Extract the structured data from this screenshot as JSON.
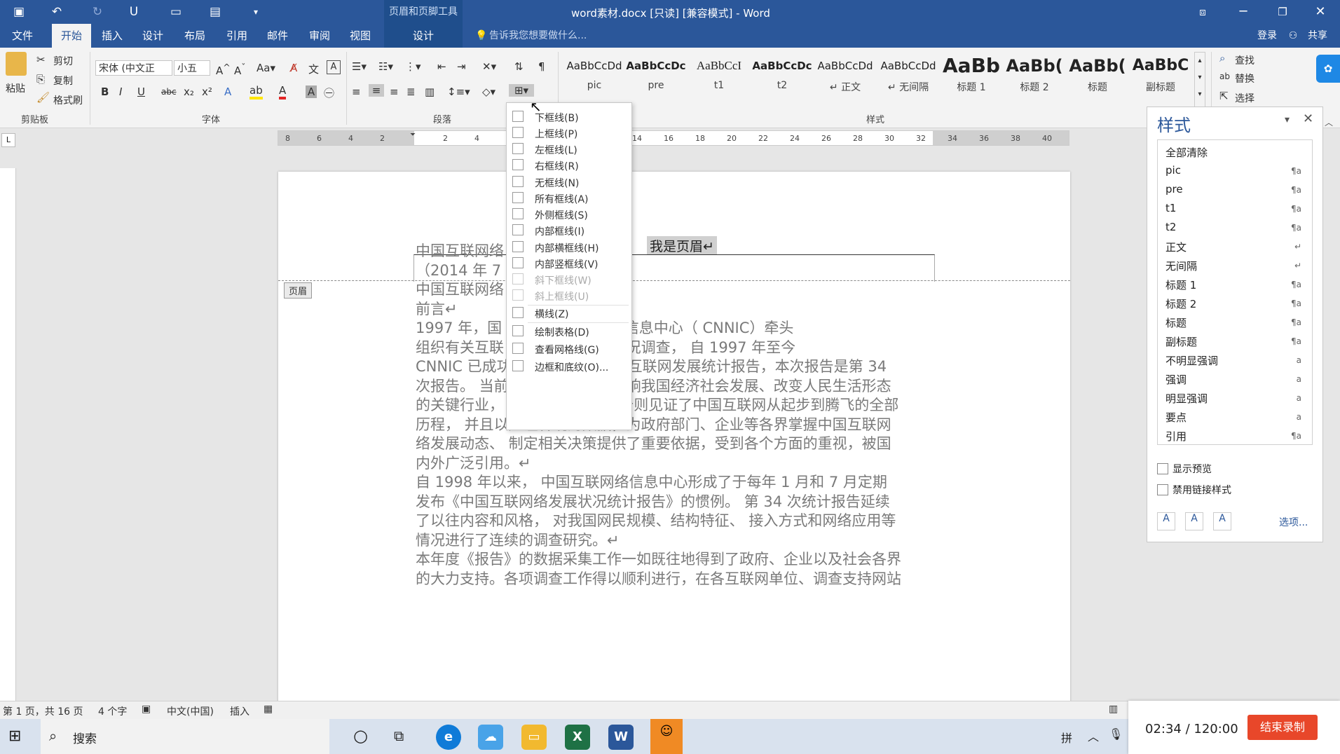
{
  "window": {
    "title": "word素材.docx [只读] [兼容模式] - Word",
    "context_label": "页眉和页脚工具"
  },
  "tabs": [
    "文件",
    "开始",
    "插入",
    "设计",
    "布局",
    "引用",
    "邮件",
    "审阅",
    "视图",
    "设计"
  ],
  "tell_me": "告诉我您想要做什么...",
  "account": {
    "login": "登录",
    "share": "共享"
  },
  "clipboard": {
    "paste": "粘贴",
    "cut": "剪切",
    "copy": "复制",
    "format_painter": "格式刷",
    "group": "剪贴板"
  },
  "font": {
    "name": "宋体 (中文正",
    "size": "小五",
    "group": "字体",
    "bold": "B",
    "italic": "I",
    "underline": "U"
  },
  "paragraph": {
    "group": "段落"
  },
  "styles_group": {
    "group": "样式",
    "tiles": [
      {
        "sample": "AaBbCcDd",
        "name": "pic"
      },
      {
        "sample": "AaBbCcDc",
        "name": "pre"
      },
      {
        "sample": "AaBbCcI",
        "name": "t1"
      },
      {
        "sample": "AaBbCcDc",
        "name": "t2"
      },
      {
        "sample": "AaBbCcDd",
        "name": "↵ 正文"
      },
      {
        "sample": "AaBbCcDd",
        "name": "↵ 无间隔"
      },
      {
        "sample": "AaBb",
        "name": "标题 1"
      },
      {
        "sample": "AaBb(",
        "name": "标题 2"
      },
      {
        "sample": "AaBb(",
        "name": "标题"
      },
      {
        "sample": "AaBbC",
        "name": "副标题"
      }
    ]
  },
  "editing": {
    "find": "查找",
    "replace": "替换",
    "select": "选择"
  },
  "ruler_numbers": [
    "8",
    "6",
    "4",
    "2",
    "",
    "2",
    "4",
    "",
    "",
    "",
    "",
    "14",
    "16",
    "18",
    "20",
    "22",
    "24",
    "26",
    "28",
    "30",
    "32",
    "34",
    "36",
    "38",
    "40"
  ],
  "document": {
    "header_text": "我是页眉↵",
    "header_tag": "页眉",
    "lines": [
      "中国互联网络                      行↵",
      "（2014 年 7",
      "中国互联网络",
      "前言↵",
      "1997 年，国                        定由中国互联网络信息中心（ CNNIC）牵头",
      "组织有关互联                        互联网行业发展状况调查，  自 1997 年至今",
      "CNNIC 已成功发布了 33 次全国互联网发展统计报告，本次报告是第 34",
      "次报告。 当前互联网已经成为影响我国经济社会发展、改变人民生活形态",
      "的关键行业， CNNIC 的历次报告则见证了中国互联网从起步到腾飞的全部",
      "历程， 并且以严谨客观的数据，为政府部门、企业等各界掌握中国互联网",
      "络发展动态、 制定相关决策提供了重要依据，受到各个方面的重视，被国",
      "内外广泛引用。↵",
      "自 1998 年以来， 中国互联网络信息中心形成了于每年 1 月和 7 月定期",
      "发布《中国互联网络发展状况统计报告》的惯例。 第 34 次统计报告延续",
      "了以往内容和风格， 对我国网民规模、结构特征、 接入方式和网络应用等",
      "情况进行了连续的调查研究。↵",
      "本年度《报告》的数据采集工作一如既往地得到了政府、企业以及社会各界",
      "的大力支持。各项调查工作得以顺利进行，在各互联网单位、调查支持网站"
    ]
  },
  "border_menu": [
    {
      "label": "下框线(B)",
      "enabled": true
    },
    {
      "label": "上框线(P)",
      "enabled": true
    },
    {
      "label": "左框线(L)",
      "enabled": true
    },
    {
      "label": "右框线(R)",
      "enabled": true
    },
    {
      "label": "无框线(N)",
      "enabled": true
    },
    {
      "label": "所有框线(A)",
      "enabled": true
    },
    {
      "label": "外侧框线(S)",
      "enabled": true
    },
    {
      "label": "内部框线(I)",
      "enabled": true
    },
    {
      "label": "内部横框线(H)",
      "enabled": true
    },
    {
      "label": "内部竖框线(V)",
      "enabled": true
    },
    {
      "label": "斜下框线(W)",
      "enabled": false
    },
    {
      "label": "斜上框线(U)",
      "enabled": false
    },
    {
      "label": "横线(Z)",
      "enabled": true
    },
    {
      "label": "绘制表格(D)",
      "enabled": true
    },
    {
      "label": "查看网格线(G)",
      "enabled": true
    },
    {
      "label": "边框和底纹(O)...",
      "enabled": true
    }
  ],
  "styles_pane": {
    "title": "样式",
    "items": [
      {
        "name": "全部清除",
        "mark": ""
      },
      {
        "name": "pic",
        "mark": "¶a"
      },
      {
        "name": "pre",
        "mark": "¶a"
      },
      {
        "name": "t1",
        "mark": "¶a"
      },
      {
        "name": "t2",
        "mark": "¶a"
      },
      {
        "name": "正文",
        "mark": "↵"
      },
      {
        "name": "无间隔",
        "mark": "↵"
      },
      {
        "name": "标题 1",
        "mark": "¶a"
      },
      {
        "name": "标题 2",
        "mark": "¶a"
      },
      {
        "name": "标题",
        "mark": "¶a"
      },
      {
        "name": "副标题",
        "mark": "¶a"
      },
      {
        "name": "不明显强调",
        "mark": "a"
      },
      {
        "name": "强调",
        "mark": "a"
      },
      {
        "name": "明显强调",
        "mark": "a"
      },
      {
        "name": "要点",
        "mark": "a"
      },
      {
        "name": "引用",
        "mark": "¶a"
      }
    ],
    "show_preview": "显示预览",
    "disable_linked": "禁用链接样式",
    "options": "选项..."
  },
  "status": {
    "page": "第 1 页，共 16 页",
    "words": "4 个字",
    "lang": "中文(中国)",
    "mode": "插入"
  },
  "taskbar": {
    "search": "搜索",
    "timer": "02:34 / 120:00",
    "stop_rec": "结束录制",
    "ime": "拼"
  },
  "colors": {
    "word_blue": "#2b579a",
    "record_red": "#e8472a"
  }
}
